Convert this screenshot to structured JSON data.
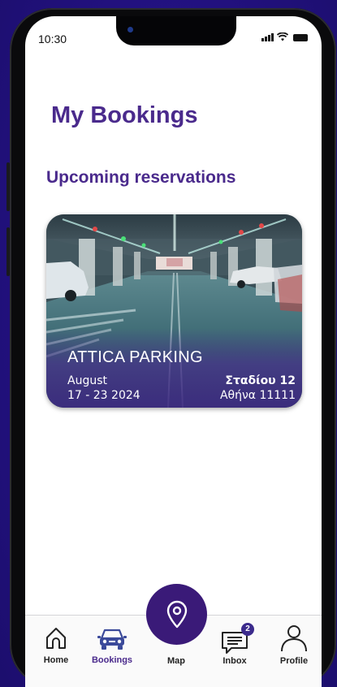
{
  "status_bar": {
    "time": "10:30"
  },
  "page": {
    "title": "My Bookings"
  },
  "section": {
    "title": "Upcoming reservations"
  },
  "booking": {
    "name": "ATTICA PARKING",
    "month": "August",
    "dates": "17 - 23 2024",
    "street": "Σταδίου 12",
    "city": "Αθήνα 11111"
  },
  "tabbar": {
    "home": "Home",
    "bookings": "Bookings",
    "map": "Map",
    "inbox": "Inbox",
    "inbox_badge": "2",
    "profile": "Profile"
  },
  "colors": {
    "background": "#26148a",
    "accent": "#4a2a8c",
    "map_button": "#3a1a78",
    "active_tab_icon": "#3b4a9a"
  },
  "icons": {
    "home": "home-icon",
    "bookings": "car-icon",
    "map": "location-pin-icon",
    "inbox": "chat-bubble-icon",
    "profile": "user-icon"
  }
}
